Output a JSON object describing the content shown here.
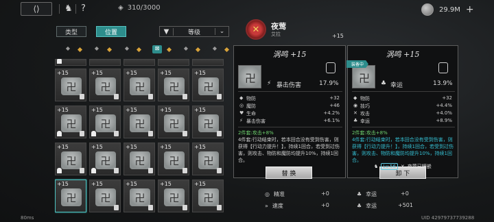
{
  "topbar": {
    "back_icon": "back-arrow-icon",
    "capacity": "310/3000",
    "currency": "29.9M"
  },
  "tabs": [
    {
      "label": "类型",
      "active": false
    },
    {
      "label": "位置",
      "active": true
    }
  ],
  "filter": {
    "label": "等级"
  },
  "character": {
    "name": "夜莺",
    "sub": "艾拉",
    "emblem_icon": "crossed-blades-icon"
  },
  "bg_level": "+15",
  "grid": {
    "rows": [
      [
        "+15",
        "+15",
        "+15",
        "+15",
        "+15"
      ],
      [
        "+15",
        "+15",
        "+15",
        "+15",
        "+15"
      ],
      [
        "+15",
        "+15",
        "+15",
        "+15",
        "+15"
      ],
      [
        "+15",
        "+15",
        "+15",
        "+15",
        "+15"
      ]
    ]
  },
  "panel_left": {
    "title": "涡鸣 +15",
    "main_stat": {
      "label": "暴击伤害",
      "value": "17.9%"
    },
    "stats": [
      {
        "icon": "shield-icon",
        "label": "物防",
        "value": "+32"
      },
      {
        "icon": "ward-icon",
        "label": "魔防",
        "value": "+46"
      },
      {
        "icon": "heart-icon",
        "label": "生命",
        "value": "+4.2%"
      },
      {
        "icon": "crit-icon",
        "label": "暴击伤害",
        "value": "+6.1%"
      }
    ],
    "set_line1": "2件套:攻击+8%",
    "set_line2": "4件套:行动结束时，若本回合没有受到伤害，则获得【行动力提升！】，持续1回合，若受到过伤害，则攻击、物防和魔防均提升10%，持续1回合。",
    "button": "替 换"
  },
  "panel_right": {
    "badge": "装备中",
    "title": "涡鸣 +15",
    "main_stat": {
      "label": "幸运",
      "value": "13.9%"
    },
    "stats": [
      {
        "icon": "shield-icon",
        "label": "物防",
        "value": "+32"
      },
      {
        "icon": "skill-icon",
        "label": "技巧",
        "value": "+4.4%"
      },
      {
        "icon": "sword-icon",
        "label": "攻击",
        "value": "+4.0%"
      },
      {
        "icon": "clover-icon",
        "label": "幸运",
        "value": "+8.9%"
      }
    ],
    "set_line1": "2件套:攻击+8%",
    "set_line2": "4件套:行动结束时，若本回合没有受到伤害，则获得【行动力提升！】，持续1回合，若受到过伤害，则攻击、物防和魔防均提升10%，持续1回合。",
    "level": "Lv.56",
    "equipped_by": "夜莺已镶嵌",
    "button": "卸 下"
  },
  "bottom_stats": [
    {
      "label": "精准",
      "value": "+0"
    },
    {
      "label": "幸运",
      "value": "+0"
    },
    {
      "label": "速度",
      "value": "+0"
    },
    {
      "label": "幸运",
      "value": "+501"
    }
  ],
  "footer": {
    "left": "80ms",
    "right": "UID 42979737739288"
  }
}
